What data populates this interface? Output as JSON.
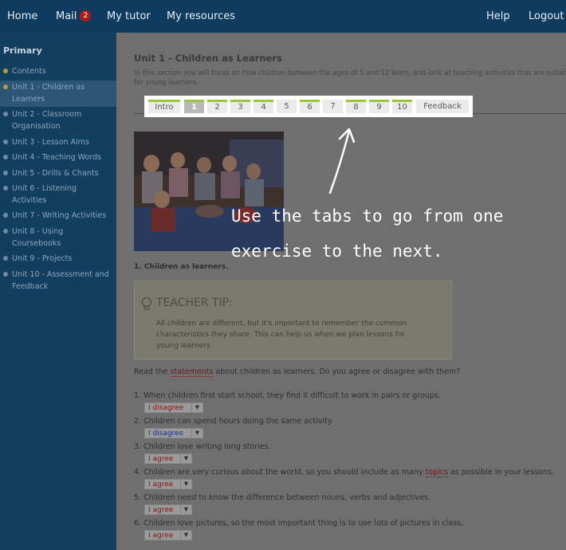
{
  "nav": {
    "home": "Home",
    "mail": "Mail",
    "mail_count": "2",
    "tutor": "My tutor",
    "resources": "My resources",
    "help": "Help",
    "logout": "Logout"
  },
  "sidebar": {
    "title": "Primary",
    "items": [
      {
        "label": "Contents"
      },
      {
        "label": "Unit 1 - Children as Learners"
      },
      {
        "label": "Unit 2 - Classroom Organisation"
      },
      {
        "label": "Unit 3 - Lesson Aims"
      },
      {
        "label": "Unit 4 - Teaching Words"
      },
      {
        "label": "Unit 5 - Drills & Chants"
      },
      {
        "label": "Unit 6 - Listening Activities"
      },
      {
        "label": "Unit 7 - Writing Activities"
      },
      {
        "label": "Unit 8 - Using Coursebooks"
      },
      {
        "label": "Unit 9 - Projects"
      },
      {
        "label": "Unit 10 - Assessment and Feedback"
      }
    ]
  },
  "main": {
    "title": "Unit 1 - Children as Learners",
    "intro": "In this section you will focus on how children between the ages of 5 and 12 learn, and look at teaching activities that are suitable for young learners.",
    "tabs": [
      "Intro",
      "1",
      "2",
      "3",
      "4",
      "5",
      "6",
      "7",
      "8",
      "9",
      "10",
      "Feedback"
    ],
    "section_heading": "1. Children as learners.",
    "tip_heading": "TEACHER TIP:",
    "tip_text": "All children are different, but it's important to remember the common characteristics they share. This can help us when we plan lessons for young learners.",
    "prompt_before": "Read the ",
    "prompt_link": "statements",
    "prompt_after": " about children as learners. Do you agree or disagree with them?",
    "questions": [
      {
        "text": "1. When children first start school, they find it difficult to work in pairs or groups.",
        "answer": "I disagree"
      },
      {
        "text": "2. Children can spend hours doing the same activity.",
        "answer": "I disagree"
      },
      {
        "text": "3. Children love writing long stories.",
        "answer": "I agree"
      },
      {
        "before": "4. Children are very curious about the world, so you should include as many ",
        "link": "topics",
        "after": " as possible in your lessons.",
        "answer": "I agree"
      },
      {
        "text": "5. Children need to know the difference between nouns, verbs and adjectives.",
        "answer": "I agree"
      },
      {
        "text": "6. Children love pictures, so the most important thing is to use lots of pictures in class.",
        "answer": "I agree"
      }
    ]
  },
  "overlay": {
    "line1": "Use the tabs to go from one",
    "line2": "exercise to the next."
  },
  "colors": {
    "nav_bg": "#0e3b5e",
    "accent_green": "#9bc53c",
    "answer_red": "#8a1010",
    "answer_blue": "#1b2f8a"
  }
}
